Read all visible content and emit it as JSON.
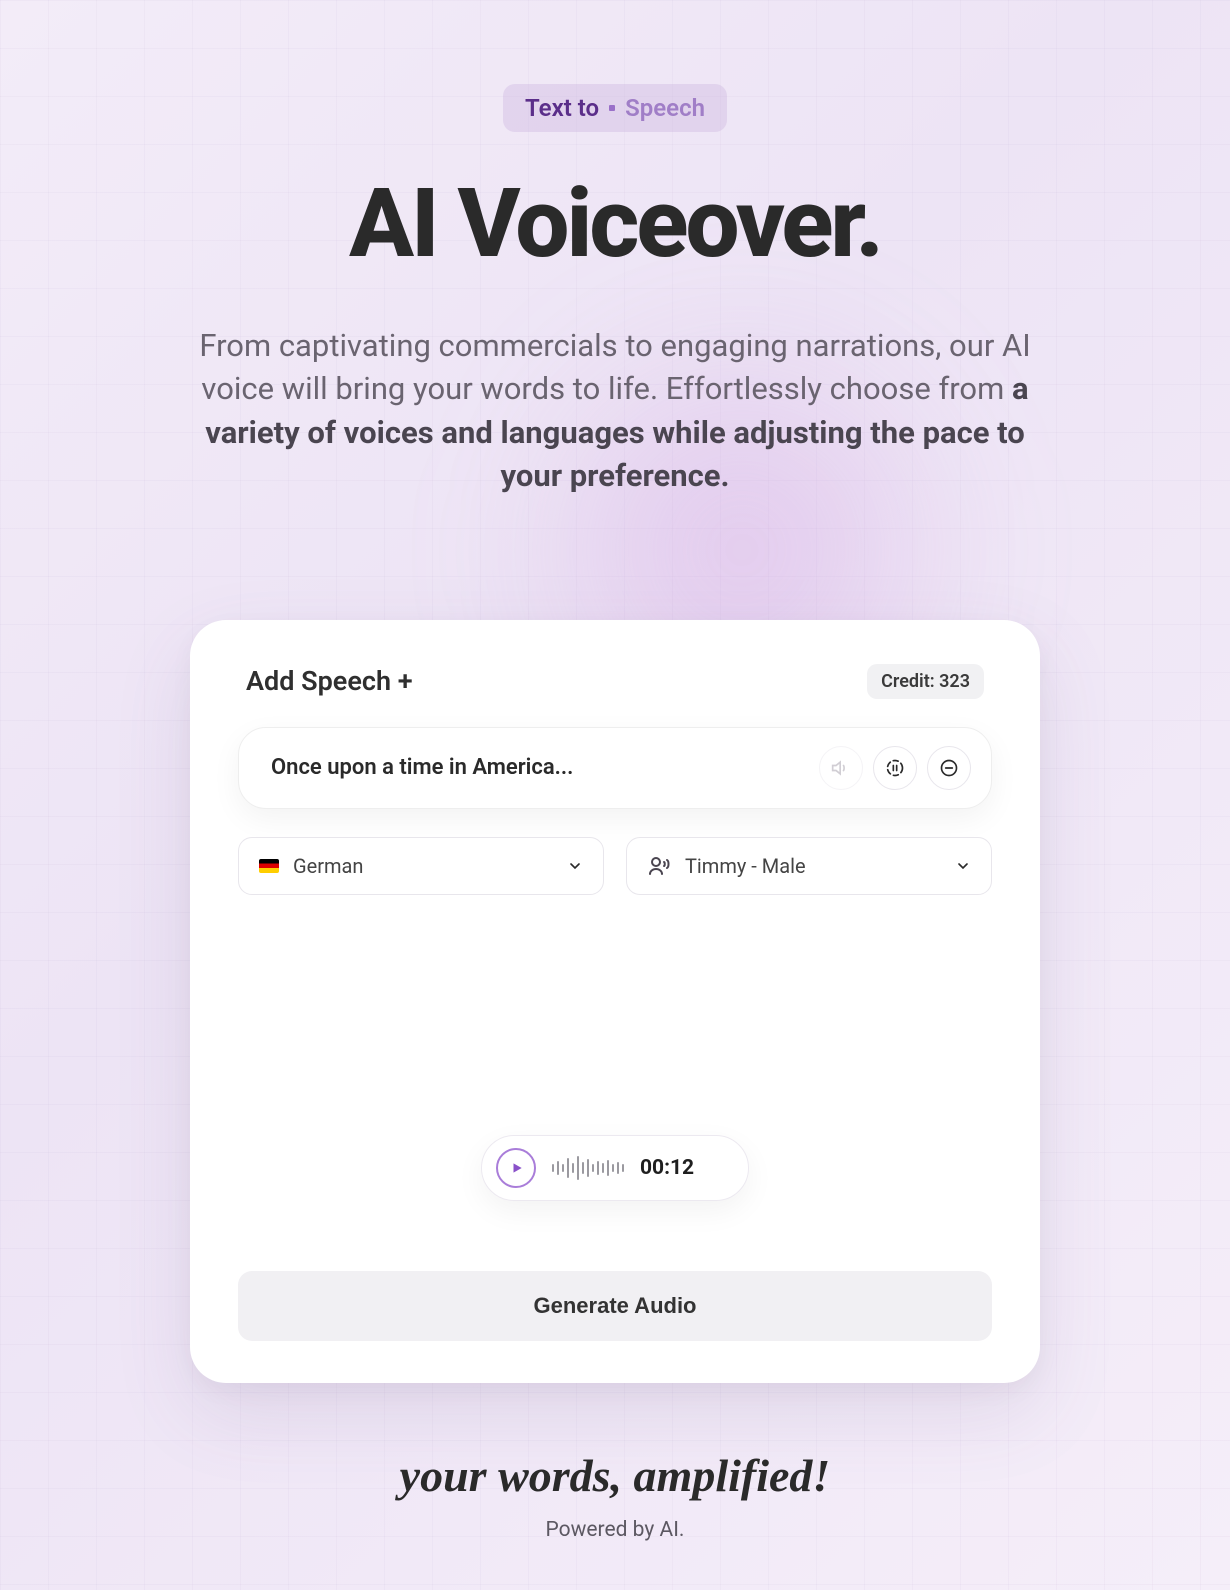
{
  "header": {
    "tag_left": "Text to",
    "tag_right": "Speech",
    "title": "AI Voiceover.",
    "desc_part1": "From captivating commercials to engaging narrations, our AI voice will bring your words to life. Effortlessly choose from ",
    "desc_bold": "a variety of voices and languages while adjusting the pace to your preference."
  },
  "card": {
    "add_speech_label": "Add Speech +",
    "credit_label": "Credit: 323",
    "input_text": "Once upon a time in America...",
    "language": {
      "label": "German"
    },
    "voice": {
      "label": "Timmy - Male"
    },
    "timecode": "00:12",
    "generate_label": "Generate Audio"
  },
  "footer": {
    "tagline": "your words, amplified!",
    "powered": "Powered by AI."
  }
}
